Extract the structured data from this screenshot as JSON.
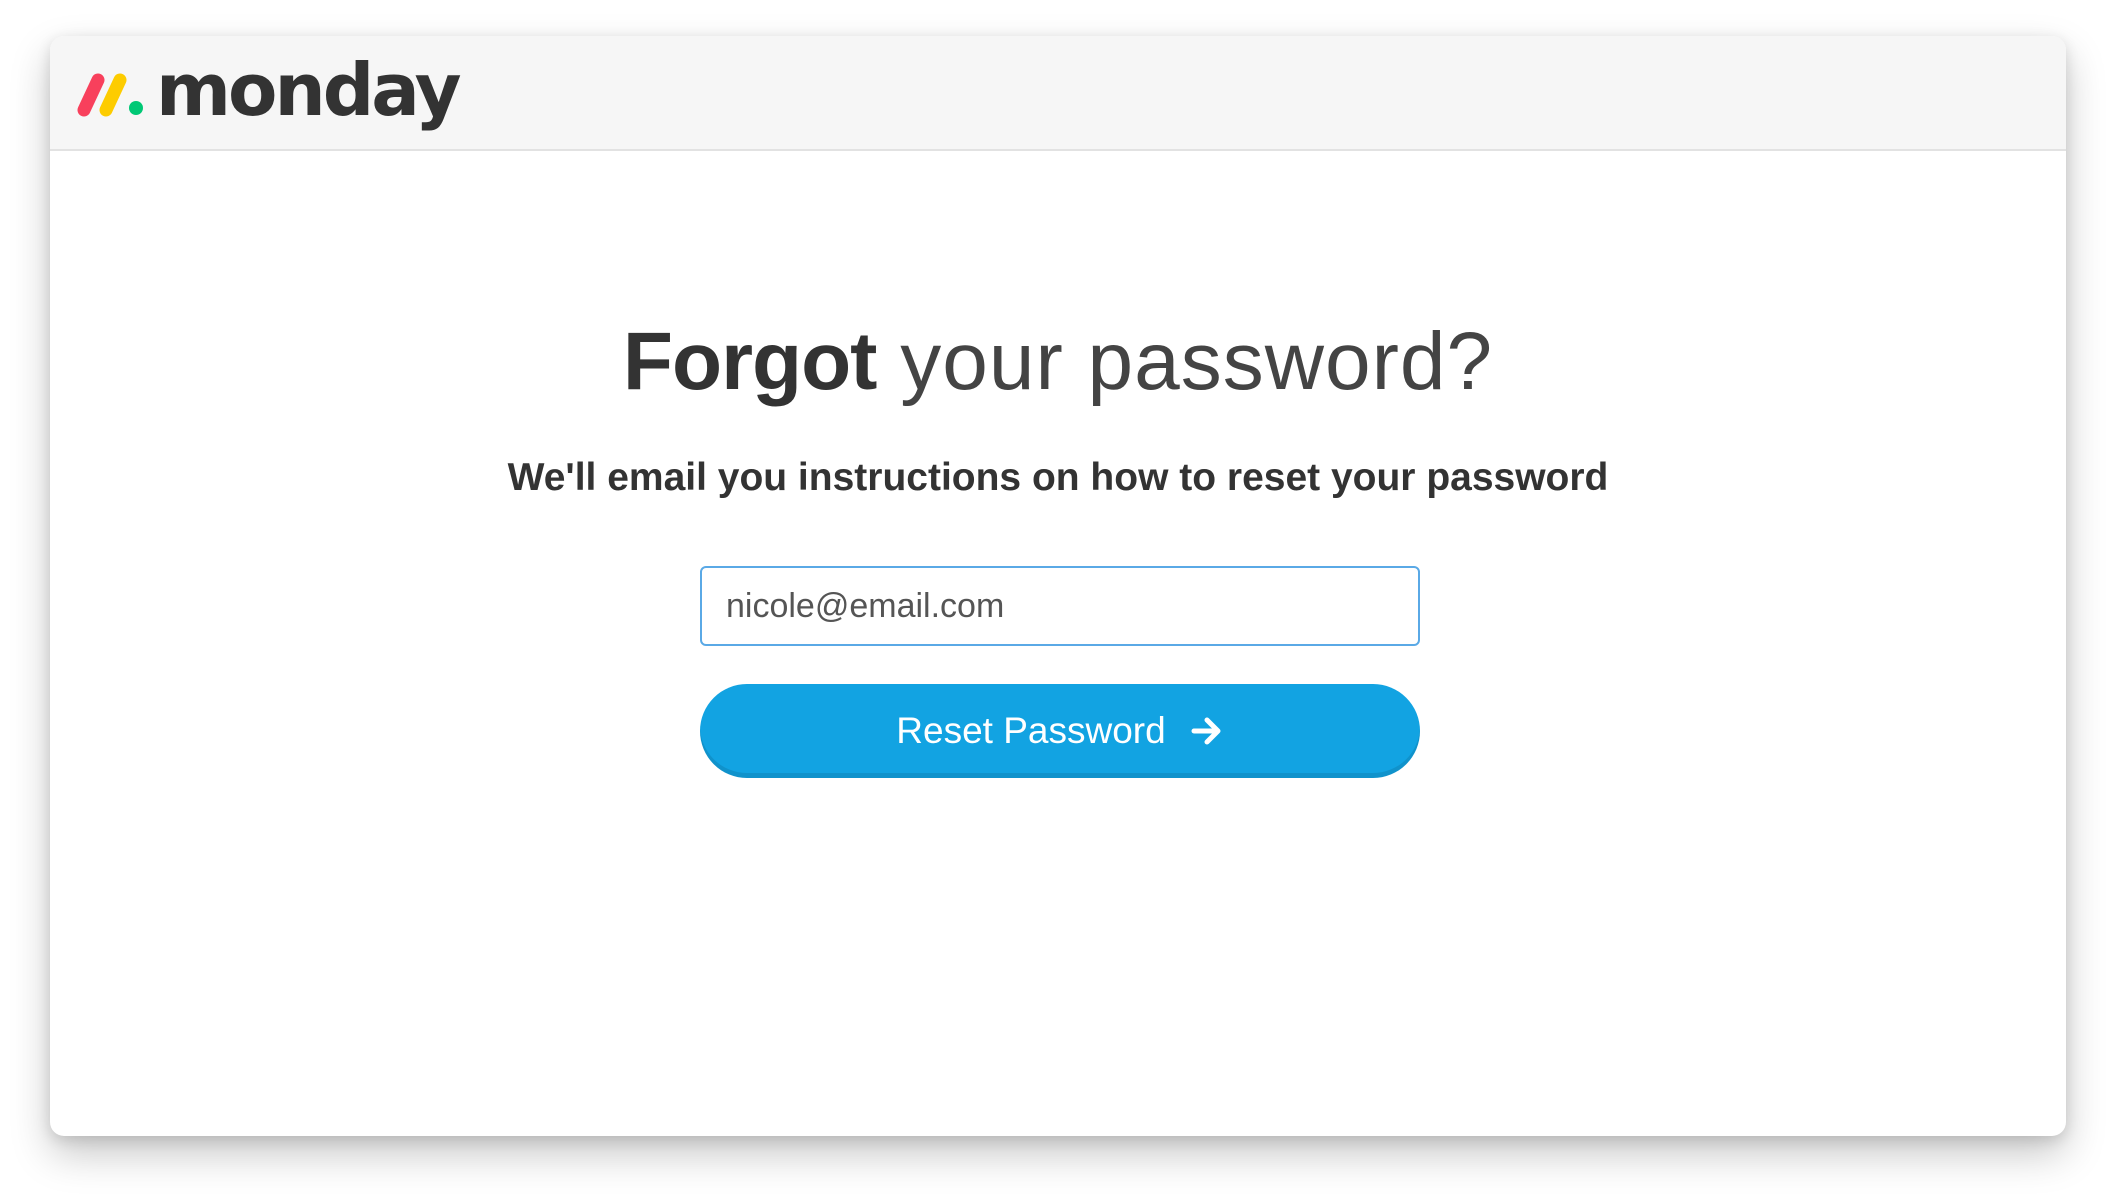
{
  "brand": {
    "name": "monday",
    "logo_icon": "monday-logo-icon",
    "logo_colors": [
      "#f8405c",
      "#fdcc00",
      "#00c875"
    ]
  },
  "page": {
    "heading_bold": "Forgot",
    "heading_light": " your password?",
    "subheading": "We'll email you instructions on how to reset your password"
  },
  "form": {
    "email_value": "nicole@email.com",
    "submit_label": "Reset Password",
    "submit_icon": "arrow-right-icon",
    "accent_color": "#12a3e2"
  }
}
